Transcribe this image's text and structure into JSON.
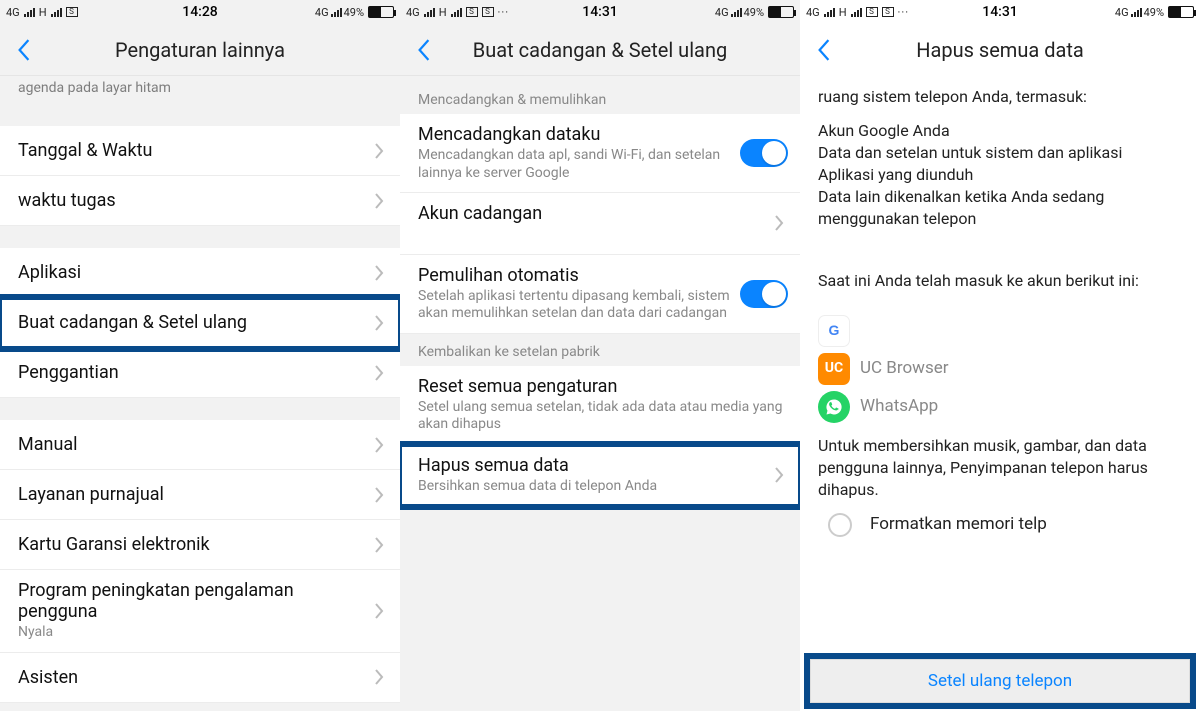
{
  "statusbar": {
    "net": "4G",
    "carrier": "H",
    "sim": "S",
    "dots": "···",
    "batt_pct": "49%",
    "rnet": "4G"
  },
  "panel1": {
    "time": "14:28",
    "title": "Pengaturan lainnya",
    "truncated_top": "agenda pada layar hitam",
    "items": {
      "date_time": "Tanggal & Waktu",
      "task_time": "waktu tugas",
      "apps": "Aplikasi",
      "backup_reset": "Buat cadangan & Setel ulang",
      "replacement": "Penggantian",
      "manual": "Manual",
      "aftersales": "Layanan purnajual",
      "warranty": "Kartu Garansi elektronik",
      "uep": "Program peningkatan pengalaman pengguna",
      "uep_state": "Nyala",
      "assistant": "Asisten"
    }
  },
  "panel2": {
    "time": "14:31",
    "title": "Buat cadangan & Setel ulang",
    "sec1": "Mencadangkan & memulihkan",
    "backup_my": {
      "title": "Mencadangkan dataku",
      "sub": "Mencadangkan data apl, sandi Wi-Fi, dan setelan lainnya ke server Google"
    },
    "backup_acct": {
      "title": "Akun cadangan"
    },
    "auto_restore": {
      "title": "Pemulihan otomatis",
      "sub": "Setelah aplikasi tertentu dipasang kembali, sistem akan memulihkan setelan dan data dari cadangan"
    },
    "sec2": "Kembalikan ke setelan pabrik",
    "reset_settings": {
      "title": "Reset semua pengaturan",
      "sub": "Setel ulang semua setelan, tidak ada data atau media yang akan dihapus"
    },
    "erase_all": {
      "title": "Hapus semua data",
      "sub": "Bersihkan semua data di telepon Anda"
    }
  },
  "panel3": {
    "time": "14:31",
    "title": "Hapus semua data",
    "intro": "ruang sistem telepon Anda, termasuk:",
    "bullets": {
      "l1": "Akun Google Anda",
      "l2": "Data dan setelan untuk sistem dan aplikasi",
      "l3": "Aplikasi yang diunduh",
      "l4": "Data lain dikenalkan ketika Anda sedang menggunakan telepon"
    },
    "signed_in": "Saat ini Anda telah masuk ke akun berikut ini:",
    "accounts": {
      "uc": "UC Browser",
      "wa": "WhatsApp"
    },
    "note": "Untuk membersihkan musik, gambar, dan data pengguna lainnya, Penyimpanan telepon harus dihapus.",
    "checkbox": "Formatkan memori telp",
    "button": "Setel ulang telepon"
  }
}
